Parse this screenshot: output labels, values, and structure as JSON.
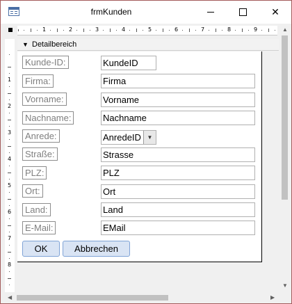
{
  "window": {
    "title": "frmKunden",
    "min_icon": "minimize-icon",
    "max_icon": "maximize-icon",
    "close_glyph": "✕"
  },
  "ruler": {
    "h_numbers": [
      "1",
      "2",
      "3",
      "4",
      "5",
      "6",
      "7",
      "8",
      "9"
    ],
    "v_numbers": [
      "1",
      "2",
      "3",
      "4",
      "5",
      "6",
      "7",
      "8"
    ]
  },
  "section": {
    "label": "Detailbereich",
    "icon": "section-arrow-icon"
  },
  "fields": [
    {
      "label": "Kunde-ID:",
      "value": "KundeID"
    },
    {
      "label": "Firma:",
      "value": "Firma"
    },
    {
      "label": "Vorname:",
      "value": "Vorname"
    },
    {
      "label": "Nachname:",
      "value": "Nachname"
    },
    {
      "label": "Anrede:",
      "value": "AnredeID"
    },
    {
      "label": "Straße:",
      "value": "Strasse"
    },
    {
      "label": "PLZ:",
      "value": "PLZ"
    },
    {
      "label": "Ort:",
      "value": "Ort"
    },
    {
      "label": "Land:",
      "value": "Land"
    },
    {
      "label": "E-Mail:",
      "value": "EMail"
    }
  ],
  "buttons": {
    "ok": "OK",
    "cancel": "Abbrechen"
  }
}
